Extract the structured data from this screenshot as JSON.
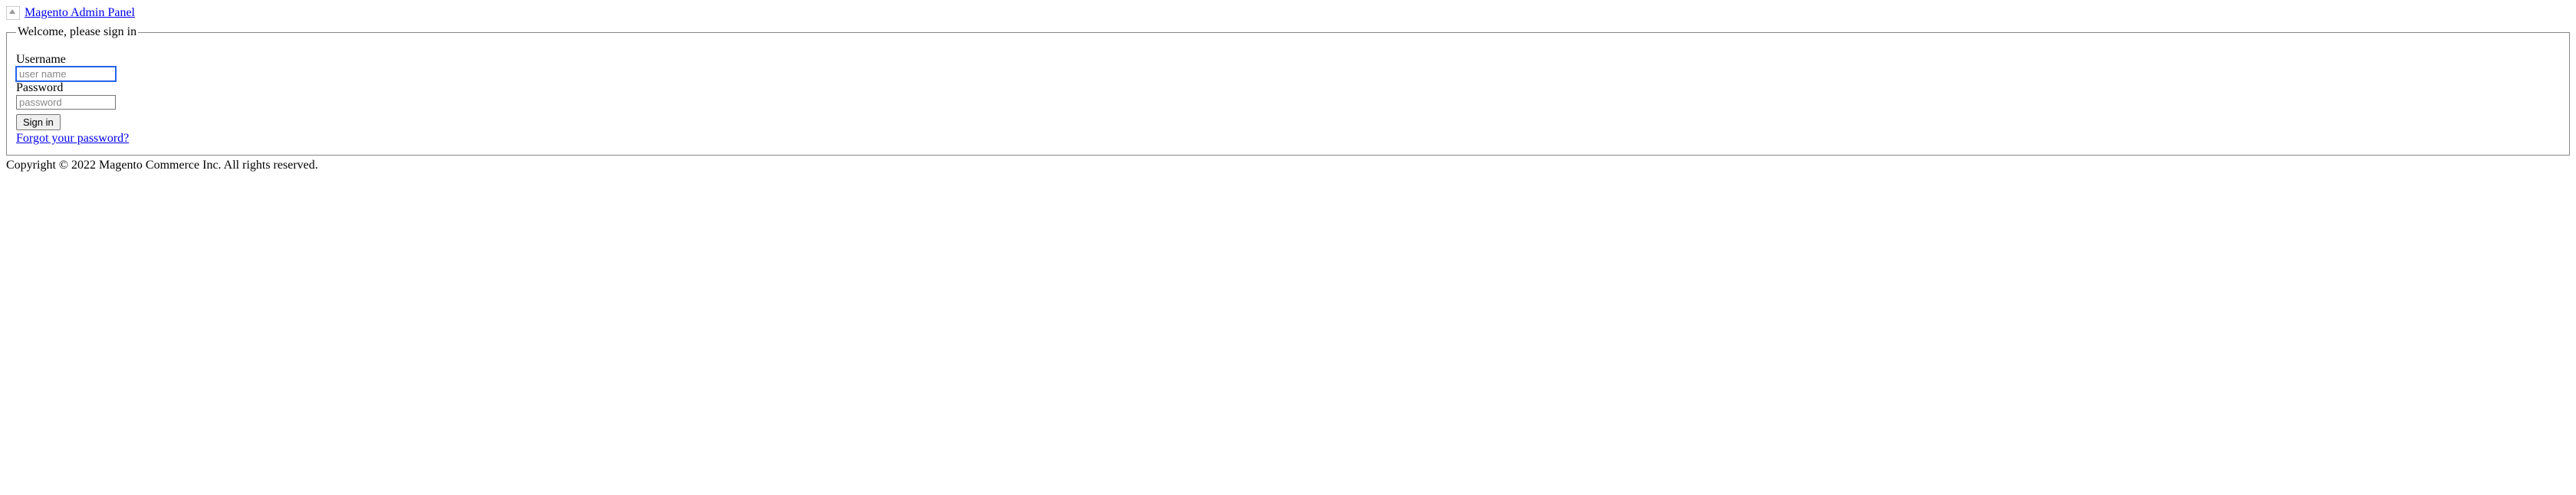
{
  "logo": {
    "alt": "Magento Admin Panel"
  },
  "form": {
    "legend": "Welcome, please sign in",
    "username_label": "Username",
    "username_placeholder": "user name",
    "password_label": "Password",
    "password_placeholder": "password",
    "signin_button": "Sign in",
    "forgot_link": "Forgot your password?"
  },
  "footer": {
    "copyright": "Copyright © 2022 Magento Commerce Inc. All rights reserved."
  }
}
